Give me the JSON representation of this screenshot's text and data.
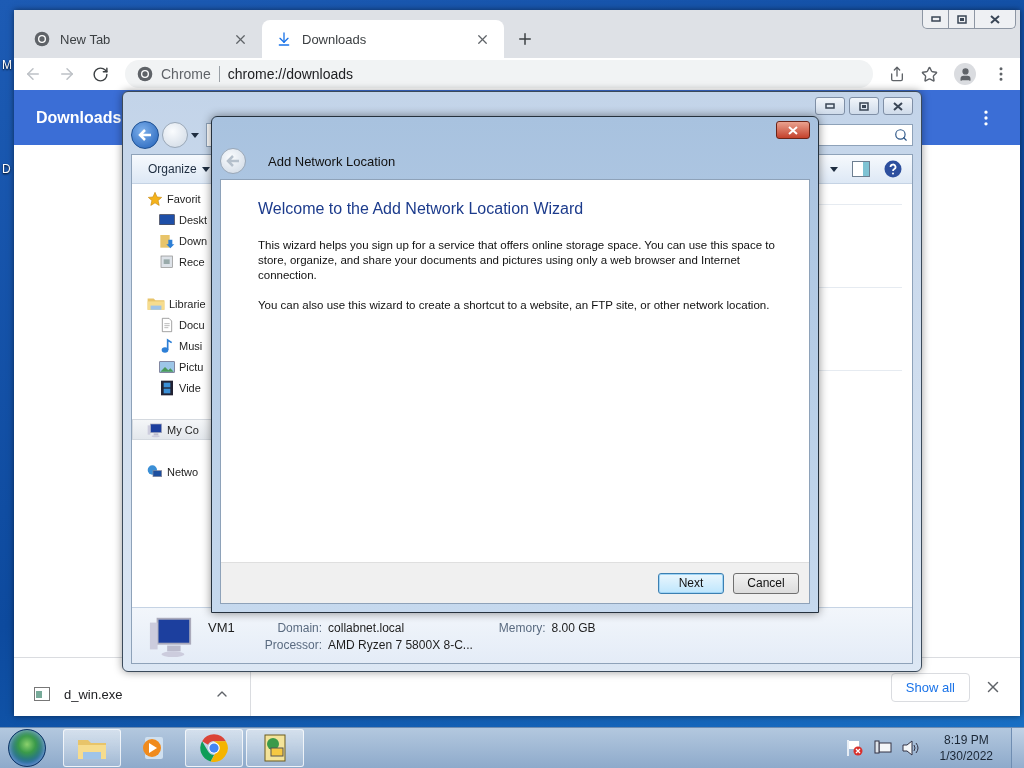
{
  "desktop": {
    "icon_labels": [
      "M",
      "D"
    ]
  },
  "chrome": {
    "tabs": [
      {
        "title": "New Tab",
        "selected": false
      },
      {
        "title": "Downloads",
        "selected": true
      }
    ],
    "omnibox": {
      "site": "Chrome",
      "url": "chrome://downloads"
    },
    "page_header": {
      "title": "Downloads"
    },
    "download_shelf": {
      "items": [
        {
          "name": "d_win.exe"
        }
      ],
      "show_all": "Show all"
    }
  },
  "explorer": {
    "back_enabled": true,
    "forward_enabled": false,
    "toolbar": {
      "organize": "Organize"
    },
    "nav_pane": [
      {
        "label": "Favorit",
        "selected": false,
        "children": [
          {
            "label": "Deskt",
            "selected": false
          },
          {
            "label": "Down",
            "selected": false
          },
          {
            "label": "Rece",
            "selected": false
          }
        ]
      },
      {
        "label": "Librarie",
        "selected": false,
        "children": [
          {
            "label": "Docu",
            "selected": false
          },
          {
            "label": "Musi",
            "selected": false
          },
          {
            "label": "Pictu",
            "selected": false
          },
          {
            "label": "Vide",
            "selected": false
          }
        ]
      },
      {
        "label": "My Co",
        "selected": true
      },
      {
        "label": "Netwo",
        "selected": false
      }
    ],
    "details": {
      "name": "VM1",
      "rows": [
        [
          {
            "label": "Domain:",
            "value": "collabnet.local"
          },
          {
            "label": "Memory:",
            "value": "8.00 GB"
          }
        ],
        [
          {
            "label": "Processor:",
            "value": "AMD Ryzen 7 5800X 8-C..."
          }
        ]
      ]
    }
  },
  "wizard": {
    "title": "Add Network Location",
    "back_enabled": false,
    "heading": "Welcome to the Add Network Location Wizard",
    "paragraphs": [
      "This wizard helps you sign up for a service that offers online storage space.  You can use this space to store, organize, and share your documents and pictures using only a web browser and Internet connection.",
      "You can also use this wizard to create a shortcut to a website, an FTP site, or other network location."
    ],
    "buttons": [
      {
        "label": "Next",
        "default": true
      },
      {
        "label": "Cancel",
        "default": false
      }
    ]
  },
  "taskbar": {
    "apps": [
      {
        "running": true
      },
      {
        "running": false
      },
      {
        "running": true
      },
      {
        "running": true
      }
    ],
    "clock": {
      "time": "8:19 PM",
      "date": "1/30/2022"
    }
  }
}
